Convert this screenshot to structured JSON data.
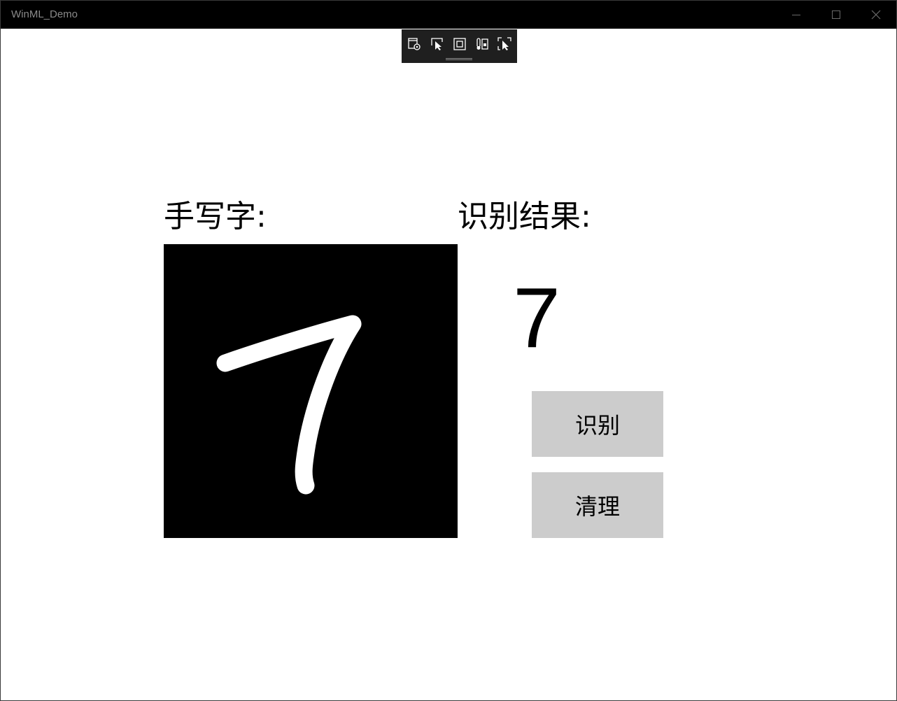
{
  "window": {
    "title": "WinML_Demo",
    "controls": {
      "minimize_icon": "minimize-icon",
      "maximize_icon": "maximize-icon",
      "close_icon": "close-icon"
    }
  },
  "debug_toolbar": {
    "items": [
      {
        "icon": "live-visual-tree-icon"
      },
      {
        "icon": "select-element-icon"
      },
      {
        "icon": "display-layout-adorners-icon"
      },
      {
        "icon": "track-focus-icon"
      },
      {
        "icon": "hot-reload-icon"
      }
    ]
  },
  "main": {
    "handwriting_label": "手写字:",
    "result_label": "识别结果:",
    "result_value": "7",
    "recognize_button": "识别",
    "clear_button": "清理"
  },
  "colors": {
    "titlebar": "#000000",
    "canvas_background": "#000000",
    "stroke": "#ffffff",
    "button_background": "#cccccc",
    "debug_toolbar": "#1f1f1f"
  }
}
